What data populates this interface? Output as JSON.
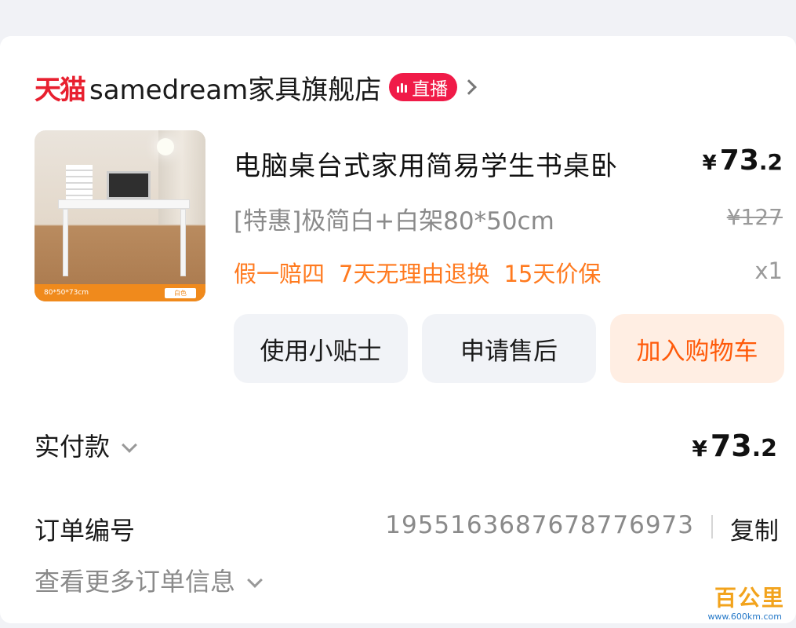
{
  "shop": {
    "logo": "天猫",
    "name": "samedream家具旗舰店",
    "live_badge": "直播"
  },
  "product": {
    "image_caption_left": "80*50*73cm",
    "image_caption_chip": "白色",
    "title": "电脑桌台式家用简易学生书桌卧",
    "price_symbol": "¥",
    "price_int": "73",
    "price_dec": ".2",
    "sku": "[特惠]极简白+白架80*50cm",
    "original_price": "¥127",
    "tags": [
      "假一赔四",
      "7天无理由退换",
      "15天价保"
    ],
    "quantity": "x1"
  },
  "actions": {
    "tips": "使用小贴士",
    "after_sale": "申请售后",
    "add_to_cart": "加入购物车"
  },
  "payment": {
    "label": "实付款",
    "symbol": "¥",
    "int": "73",
    "dec": ".2"
  },
  "order": {
    "label": "订单编号",
    "number": "1955163687678776973",
    "copy": "复制",
    "more": "查看更多订单信息"
  },
  "watermark": {
    "title": "百公里",
    "url": "www.600km.com"
  }
}
